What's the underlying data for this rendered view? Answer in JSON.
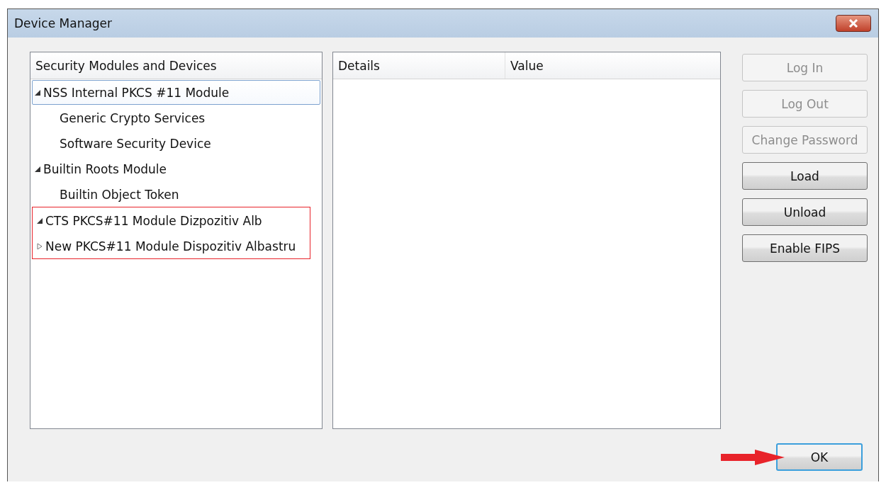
{
  "window": {
    "title": "Device Manager"
  },
  "tree": {
    "header": "Security Modules and Devices",
    "items": [
      {
        "label": "NSS Internal PKCS #11 Module",
        "expanded": true,
        "selected": true,
        "highlighted": false,
        "children": [
          {
            "label": "Generic Crypto Services",
            "selected": false,
            "highlighted": false
          },
          {
            "label": "Software Security Device",
            "selected": false,
            "highlighted": false
          }
        ]
      },
      {
        "label": "Builtin Roots Module",
        "expanded": true,
        "selected": false,
        "highlighted": false,
        "children": [
          {
            "label": "Builtin Object Token",
            "selected": false,
            "highlighted": false
          }
        ]
      },
      {
        "label": "CTS PKCS#11 Module Dizpozitiv Alb",
        "expanded": true,
        "selected": false,
        "highlighted": true
      },
      {
        "label": "New PKCS#11 Module Dispozitiv Albastru",
        "expanded": false,
        "selected": false,
        "highlighted": true
      }
    ]
  },
  "details": {
    "columns": [
      "Details",
      "Value"
    ]
  },
  "buttons": [
    {
      "label": "Log In",
      "disabled": true
    },
    {
      "label": "Log Out",
      "disabled": true
    },
    {
      "label": "Change Password",
      "disabled": true
    },
    {
      "label": "Load",
      "disabled": false
    },
    {
      "label": "Unload",
      "disabled": false
    },
    {
      "label": "Enable FIPS",
      "disabled": false
    }
  ],
  "ok_button": {
    "label": "OK",
    "focused": true,
    "pointer_arrow": true
  }
}
